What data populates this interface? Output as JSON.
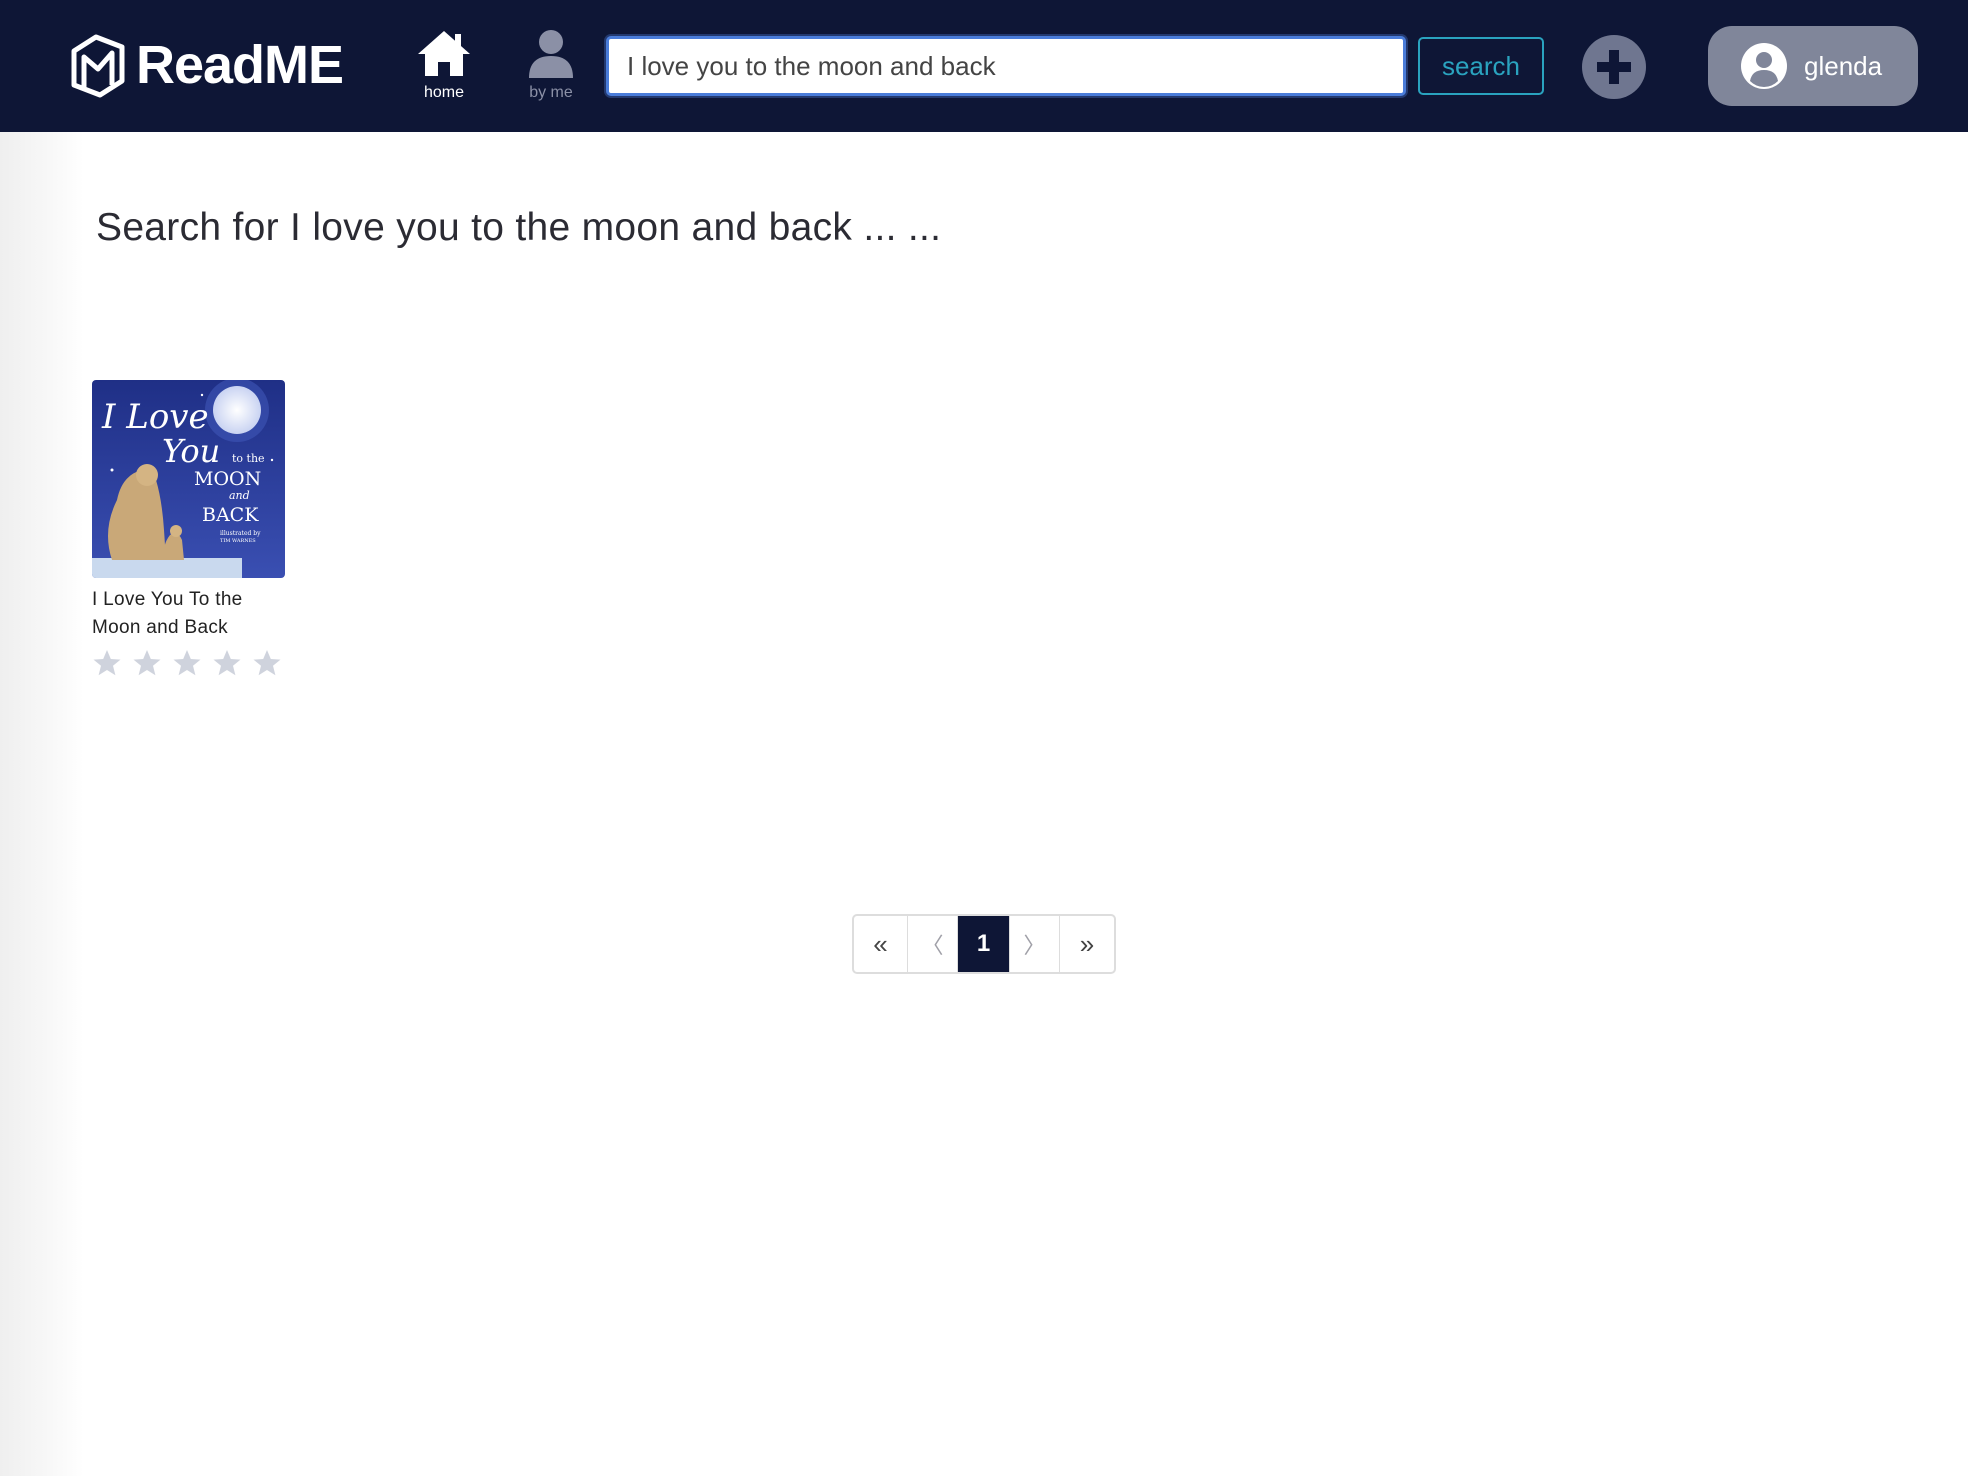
{
  "header": {
    "logo_text": "ReadME",
    "nav": {
      "home_label": "home",
      "byme_label": "by me"
    },
    "search": {
      "value": "I love you to the moon and back",
      "placeholder": "",
      "button_label": "search"
    },
    "add_icon": "plus-circle-icon",
    "user": {
      "name": "glenda",
      "icon": "user-circle-icon"
    }
  },
  "main": {
    "heading": "Search for I love you to the moon and back ... ...",
    "results": [
      {
        "title": "I Love You To the Moon and Back",
        "cover_text": [
          "I Love",
          "You",
          "to the",
          "MOON",
          "and",
          "BACK",
          "illustrated by",
          "TIM WARNES"
        ],
        "rating": 0,
        "max_rating": 5
      }
    ]
  },
  "pagination": {
    "first": "«",
    "prev": "〈",
    "current": "1",
    "next": "〉",
    "last": "»"
  },
  "colors": {
    "navbar": "#0e1636",
    "search_accent": "#2aa3bf",
    "input_focus": "#4a7cd9",
    "pill": "#80869a",
    "star_empty": "#cfd3dd"
  }
}
